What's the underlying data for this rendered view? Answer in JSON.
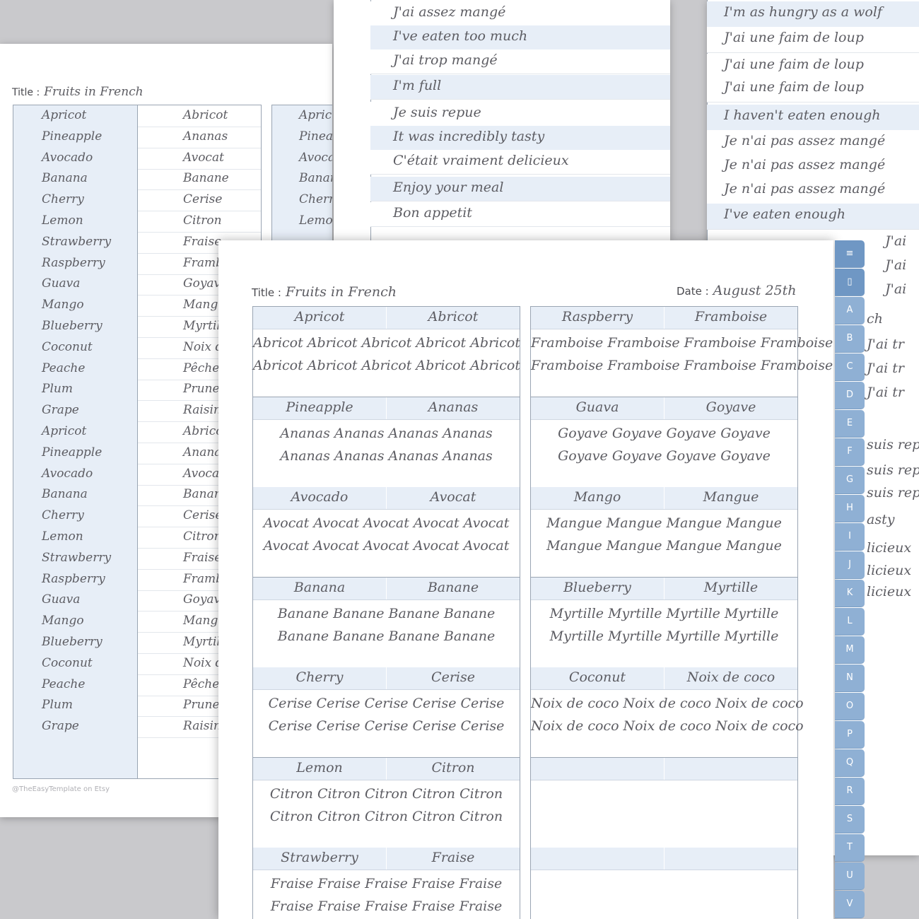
{
  "left_page": {
    "title_label": "Title :",
    "title_value": "Fruits in French",
    "english": [
      "Apricot",
      "Pineapple",
      "Avocado",
      "Banana",
      "Cherry",
      "Lemon",
      "Strawberry",
      "Raspberry",
      "Guava",
      "Mango",
      "Blueberry",
      "Coconut",
      "Peache",
      "Plum",
      "Grape",
      "Apricot",
      "Pineapple",
      "Avocado",
      "Banana",
      "Cherry",
      "Lemon",
      "Strawberry",
      "Raspberry",
      "Guava",
      "Mango",
      "Blueberry",
      "Coconut",
      "Peache",
      "Plum",
      "Grape"
    ],
    "french": [
      "Abricot",
      "Ananas",
      "Avocat",
      "Banane",
      "Cerise",
      "Citron",
      "Fraise",
      "Framboise",
      "Goyave",
      "Mangue",
      "Myrtille",
      "Noix de",
      "Pêche",
      "Prune",
      "Raisin",
      "Abricot",
      "Ananas",
      "Avocat",
      "Banane",
      "Cerise",
      "Citron",
      "Fraise",
      "Framboise",
      "Goyave",
      "Mangue",
      "Myrtille",
      "Noix de",
      "Pêche",
      "Prune",
      "Raisin"
    ],
    "second_table": [
      "Apricot",
      "Pineapple",
      "Avocado",
      "Banana",
      "Cherry",
      "Lemon"
    ],
    "credit": "@TheEasyTemplate on Etsy"
  },
  "middle_page": {
    "lines": [
      "J'ai assez mangé",
      "I've eaten too much",
      "J'ai trop mangé",
      "I'm full",
      "Je suis repue",
      "It was incredibly tasty",
      "C'était vraiment delicieux",
      "Enjoy your meal",
      "Bon appetit"
    ]
  },
  "right_page": {
    "lines": [
      "I'm as hungry as a wolf",
      "J'ai une faim de loup",
      "J'ai une faim de loup",
      "J'ai une faim de loup",
      "I haven't eaten enough",
      "Je n'ai pas assez mangé",
      "Je n'ai pas assez mangé",
      "Je n'ai pas assez mangé",
      "I've eaten enough"
    ],
    "side_fragments": [
      "J'ai",
      "J'ai",
      "J'ai",
      "ch",
      "J'ai tr",
      "J'ai tr",
      "J'ai tr",
      "suis rep",
      "suis rep",
      "suis rep",
      "asty",
      "licieux",
      "licieux",
      "licieux"
    ]
  },
  "front_page": {
    "title_label": "Title :",
    "title_value": "Fruits in French",
    "date_label": "Date :",
    "date_value": "August 25th",
    "left_blocks": [
      {
        "en": "Apricot",
        "fr": "Abricot",
        "line1": "Abricot  Abricot  Abricot  Abricot  Abricot",
        "line2": "Abricot  Abricot  Abricot  Abricot  Abricot"
      },
      {
        "en": "Pineapple",
        "fr": "Ananas",
        "line1": "Ananas   Ananas   Ananas   Ananas",
        "line2": "Ananas   Ananas   Ananas   Ananas"
      },
      {
        "en": "Avocado",
        "fr": "Avocat",
        "line1": "Avocat   Avocat   Avocat   Avocat   Avocat",
        "line2": "Avocat   Avocat   Avocat   Avocat   Avocat"
      },
      {
        "en": "Banana",
        "fr": "Banane",
        "line1": "Banane   Banane   Banane   Banane",
        "line2": "Banane   Banane   Banane   Banane"
      },
      {
        "en": "Cherry",
        "fr": "Cerise",
        "line1": "Cerise   Cerise   Cerise   Cerise   Cerise",
        "line2": "Cerise   Cerise   Cerise   Cerise   Cerise"
      },
      {
        "en": "Lemon",
        "fr": "Citron",
        "line1": "Citron   Citron   Citron   Citron   Citron",
        "line2": "Citron   Citron   Citron   Citron   Citron"
      },
      {
        "en": "Strawberry",
        "fr": "Fraise",
        "line1": "Fraise   Fraise   Fraise   Fraise   Fraise",
        "line2": "Fraise   Fraise   Fraise   Fraise   Fraise"
      }
    ],
    "right_blocks": [
      {
        "en": "Raspberry",
        "fr": "Framboise",
        "line1": "Framboise  Framboise  Framboise  Framboise",
        "line2": "Framboise  Framboise  Framboise  Framboise"
      },
      {
        "en": "Guava",
        "fr": "Goyave",
        "line1": "Goyave   Goyave   Goyave   Goyave",
        "line2": "Goyave   Goyave   Goyave   Goyave"
      },
      {
        "en": "Mango",
        "fr": "Mangue",
        "line1": "Mangue   Mangue   Mangue   Mangue",
        "line2": "Mangue   Mangue   Mangue   Mangue"
      },
      {
        "en": "Blueberry",
        "fr": "Myrtille",
        "line1": "Myrtille   Myrtille   Myrtille   Myrtille",
        "line2": "Myrtille   Myrtille   Myrtille   Myrtille"
      },
      {
        "en": "Coconut",
        "fr": "Noix de coco",
        "line1": "Noix de coco   Noix de coco   Noix de coco",
        "line2": "Noix de coco   Noix de coco   Noix de coco"
      }
    ]
  },
  "tabs": [
    "≡",
    "▯",
    "A",
    "B",
    "C",
    "D",
    "E",
    "F",
    "G",
    "H",
    "I",
    "J",
    "K",
    "L",
    "M",
    "N",
    "O",
    "P",
    "Q",
    "R",
    "S",
    "T",
    "U",
    "V"
  ],
  "colors": {
    "accent_blue": "#e7eef7",
    "tab_blue": "#8fb0d4",
    "ink": "#5d5d63",
    "rule": "#9aa5b3"
  }
}
